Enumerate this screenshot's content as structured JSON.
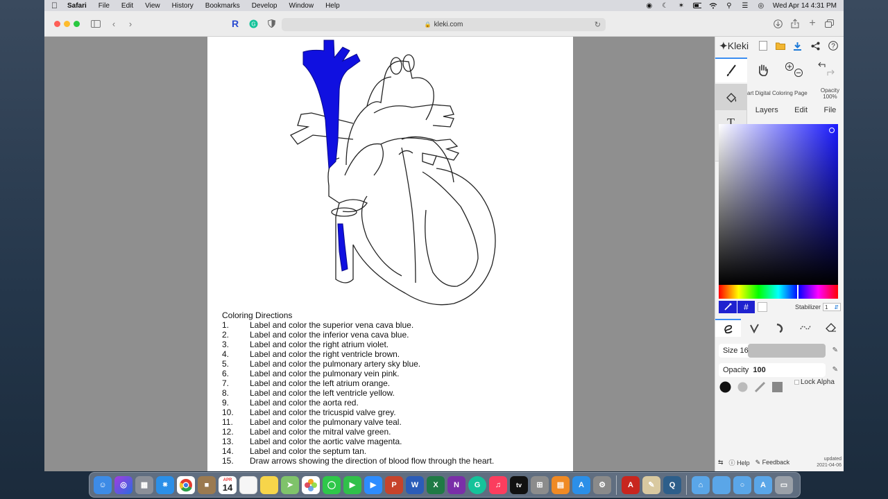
{
  "menubar": {
    "app_name": "Safari",
    "menus": [
      "File",
      "Edit",
      "View",
      "History",
      "Bookmarks",
      "Develop",
      "Window",
      "Help"
    ],
    "clock": "Wed Apr 14  4:31 PM"
  },
  "browser": {
    "url": "kleki.com"
  },
  "worksheet": {
    "directions_title": "Coloring Directions",
    "directions": [
      {
        "num": "1.",
        "text": "Label and color the superior vena cava blue."
      },
      {
        "num": "2.",
        "text": "Label and color the inferior vena cava blue."
      },
      {
        "num": "3.",
        "text": "Label and color the right atrium violet."
      },
      {
        "num": "4.",
        "text": "Label and color the right ventricle brown."
      },
      {
        "num": "5.",
        "text": "Label and color the pulmonary artery sky blue."
      },
      {
        "num": "6.",
        "text": "Label and color the pulmonary vein pink."
      },
      {
        "num": "7.",
        "text": "Label and color the left atrium orange."
      },
      {
        "num": "8.",
        "text": "Label and color the left ventricle yellow."
      },
      {
        "num": "9.",
        "text": "Label and color the aorta red."
      },
      {
        "num": "10.",
        "text": "Label and color the tricuspid valve grey."
      },
      {
        "num": "11.",
        "text": "Label and color the pulmonary valve teal."
      },
      {
        "num": "12.",
        "text": "Label and color the mitral valve green."
      },
      {
        "num": "13.",
        "text": "Label and color the aortic valve magenta."
      },
      {
        "num": "14.",
        "text": "Label and color the septum tan."
      },
      {
        "num": "15.",
        "text": "Draw arrows showing the direction of blood flow through the heart."
      }
    ],
    "fill_color": "#1010e0"
  },
  "kleki": {
    "logo": "Kleki",
    "doc_name": "art Digital Coloring Page",
    "opacity_label": "Opacity",
    "opacity_value": "100%",
    "tabs": [
      "Layers",
      "Edit",
      "File"
    ],
    "picker_icon": "eyedropper-icon",
    "hex_symbol": "#",
    "stabilizer_label": "Stabilizer",
    "stabilizer_value": "1",
    "size_label": "Size",
    "size_value": "16",
    "size_fraction": 0.27,
    "brush_opacity_label": "Opacity",
    "brush_opacity_value": "100",
    "lock_alpha_label": "Lock Alpha",
    "help_label": "Help",
    "feedback_label": "Feedback",
    "updated_label": "updated",
    "updated_date": "2021-04-06",
    "primary_color": "#1f22cf"
  },
  "dock": {
    "calendar_month": "APR",
    "calendar_day": "14"
  }
}
